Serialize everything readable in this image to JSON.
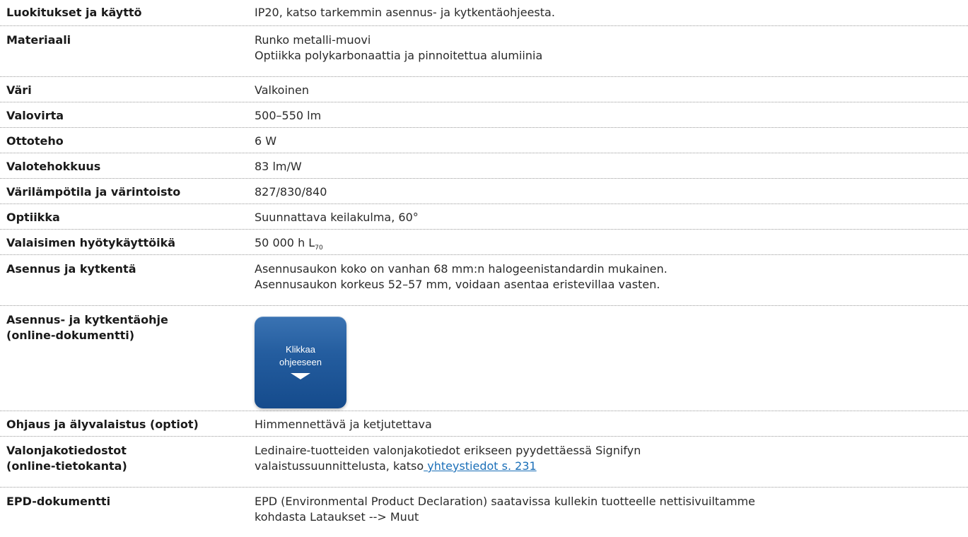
{
  "rows": [
    {
      "label": "Luokitukset ja käyttö",
      "value": [
        "IP20, katso tarkemmin asennus- ja kytkentäohjeesta."
      ]
    },
    {
      "label": "Materiaali",
      "value": [
        "Runko metalli-muovi",
        "Optiikka polykarbonaattia ja pinnoitettua alumiinia"
      ]
    },
    {
      "label": "Väri",
      "value": [
        "Valkoinen"
      ]
    },
    {
      "label": "Valovirta",
      "value": [
        "500–550 lm"
      ]
    },
    {
      "label": "Ottoteho",
      "value": [
        "6 W"
      ]
    },
    {
      "label": "Valotehokkuus",
      "value": [
        "83 lm/W"
      ]
    },
    {
      "label": "Värilämpötila ja värintoisto",
      "value": [
        "827/830/840"
      ]
    },
    {
      "label": "Optiikka",
      "value": [
        "Suunnattava keilakulma, 60°"
      ]
    },
    {
      "label": "Valaisimen hyötykäyttöikä",
      "value_main": "50 000 h L",
      "value_sub": "70"
    },
    {
      "label": "Asennus ja kytkentä",
      "value": [
        "Asennusaukon koko on vanhan 68 mm:n halogeenistandardin mukainen.",
        "Asennusaukon korkeus 52–57 mm, voidaan asentaa eristevillaa vasten."
      ]
    },
    {
      "label": [
        "Asennus- ja kytkentäohje",
        "(online-dokumentti)"
      ],
      "button": [
        "Klikkaa",
        "ohjeeseen"
      ]
    },
    {
      "label": "Ohjaus ja älyvalaistus (optiot)",
      "value": [
        "Himmennettävä ja ketjutettava"
      ]
    },
    {
      "label": [
        "Valonjakotiedostot",
        "(online-tietokanta)"
      ],
      "value": [
        "Ledinaire-tuotteiden valonjakotiedot erikseen pyydettäessä Signifyn"
      ],
      "value_prefix": "valaistussuunnittelusta, katso",
      "link": " yhteystiedot s. 231"
    },
    {
      "label": "EPD-dokumentti",
      "value": [
        "EPD (Environmental Product Declaration) saatavissa kullekin tuotteelle nettisivuiltamme",
        "kohdasta Lataukset --> Muut"
      ]
    }
  ],
  "colors": {
    "link": "#1b6fb8",
    "button": "#245d9f",
    "divider": "#9a9a9a"
  },
  "icons": {
    "button_arrow": "triangle-down-icon"
  }
}
